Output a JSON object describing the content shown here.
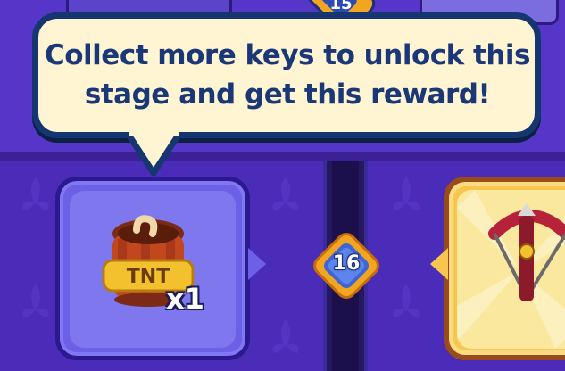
{
  "tooltip": {
    "text": "Collect more keys to unlock this stage and get this reward!"
  },
  "level": {
    "current_number": "16",
    "previous_number": "15"
  },
  "rewards": {
    "left": {
      "icon": "tnt-barrel-icon",
      "quantity_label": "x1"
    },
    "right": {
      "icon": "crossbow-icon"
    }
  },
  "colors": {
    "background": "#4a2cb8",
    "bubble_fill": "#fff5d2",
    "bubble_border": "#16366f",
    "text_dark_blue": "#1a3778",
    "card_blue": "#6b60e6",
    "card_gold": "#f7c64e"
  }
}
